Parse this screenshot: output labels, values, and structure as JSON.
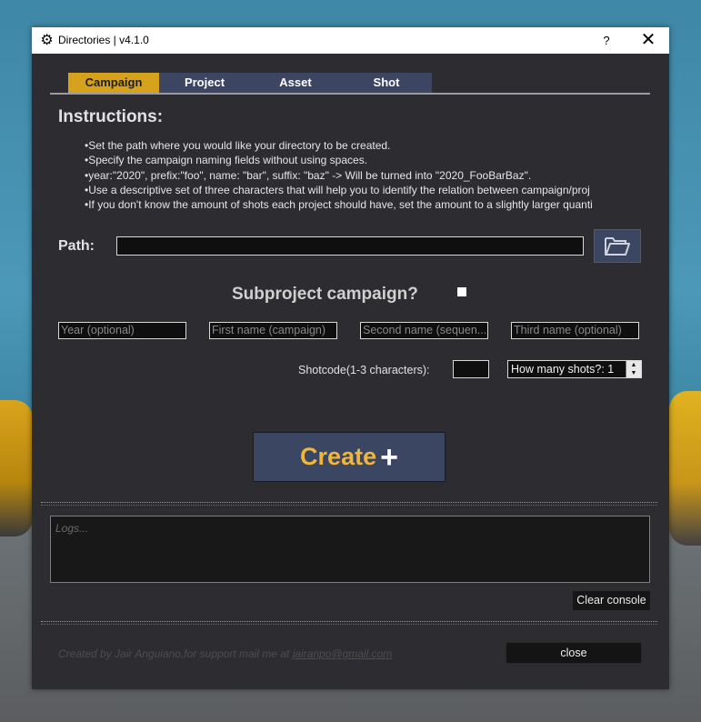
{
  "window": {
    "title": "Directories | v4.1.0",
    "help_label": "?",
    "close_label": "✕"
  },
  "tabs": [
    {
      "label": "Campaign",
      "active": true
    },
    {
      "label": "Project",
      "active": false
    },
    {
      "label": "Asset",
      "active": false
    },
    {
      "label": "Shot",
      "active": false
    }
  ],
  "instructions": {
    "title": "Instructions:",
    "bullets": [
      "Set the path where you would like your directory to be created.",
      "Specify the campaign naming fields without using spaces.",
      "year:\"2020\", prefix:\"foo\", name: \"bar\", suffix: \"baz\" -> Will be turned into \"2020_FooBarBaz\".",
      "Use a descriptive set of three characters that will help you to identify the relation between campaign/proj",
      "If you don't know the amount of shots each project should have, set the amount to a slightly larger quanti"
    ]
  },
  "path": {
    "label": "Path:",
    "value": "",
    "browse_icon": "folder-open-icon"
  },
  "subproject": {
    "label": "Subproject campaign?",
    "checked": false
  },
  "name_fields": [
    {
      "placeholder": "Year (optional)"
    },
    {
      "placeholder": "First name (campaign)"
    },
    {
      "placeholder": "Second name (sequen..."
    },
    {
      "placeholder": "Third name (optional)"
    }
  ],
  "shotcode": {
    "label": "Shotcode(1-3 characters):",
    "value": ""
  },
  "shots": {
    "prefix": "How many shots?: ",
    "value": "1"
  },
  "create": {
    "label": "Create",
    "icon": "plus-icon"
  },
  "logs": {
    "placeholder": "Logs..."
  },
  "clear_console_label": "Clear console",
  "footer": {
    "credits_text": "Created by Jair Anguiano,for support mail me at ",
    "email": "jairanpo@gmail.com",
    "close_label": "close"
  },
  "colors": {
    "active_tab": "#d6a21c",
    "tab": "#3c4663",
    "window_bg": "#2d2d31",
    "create_text": "#f0b63c"
  }
}
